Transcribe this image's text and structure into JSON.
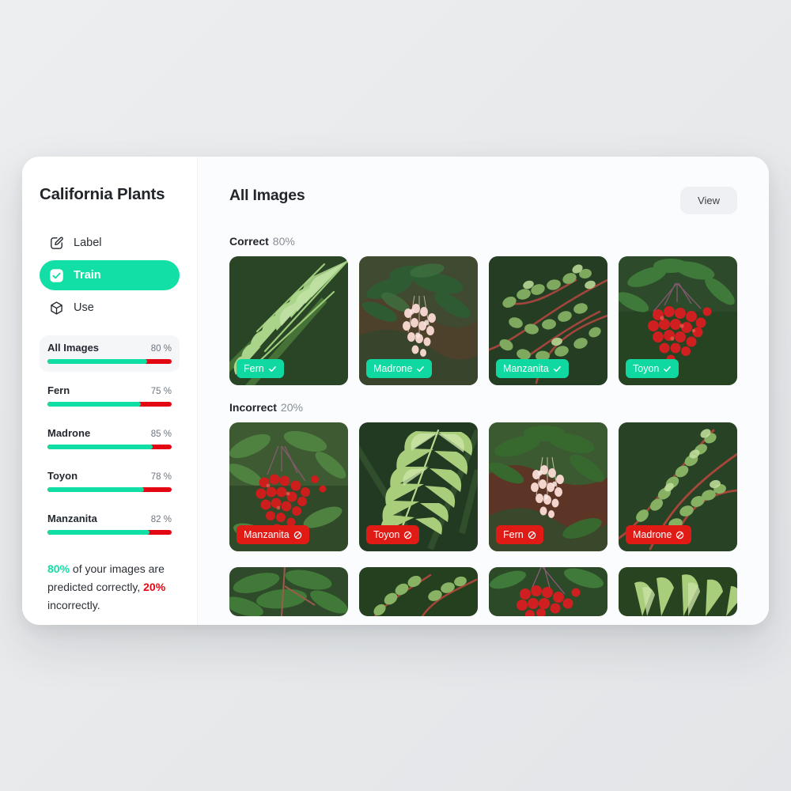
{
  "sidebar": {
    "app_title": "California Plants",
    "nav": [
      {
        "label": "Label",
        "icon": "pencil-square-icon",
        "active": false
      },
      {
        "label": "Train",
        "icon": "check-square-icon",
        "active": true
      },
      {
        "label": "Use",
        "icon": "cube-icon",
        "active": false
      }
    ],
    "progress": [
      {
        "name": "All Images",
        "value": "80 %",
        "pct": 80,
        "selected": true
      },
      {
        "name": "Fern",
        "value": "75 %",
        "pct": 75,
        "selected": false
      },
      {
        "name": "Madrone",
        "value": "85 %",
        "pct": 85,
        "selected": false
      },
      {
        "name": "Toyon",
        "value": "78 %",
        "pct": 78,
        "selected": false
      },
      {
        "name": "Manzanita",
        "value": "82 %",
        "pct": 82,
        "selected": false
      }
    ],
    "summary": {
      "correct_pct": "80%",
      "mid_text": " of your images are predicted correctly, ",
      "incorrect_pct": "20%",
      "tail_text": " incorrectly."
    }
  },
  "main": {
    "title": "All Images",
    "view_button": "View",
    "sections": [
      {
        "label": "Correct",
        "pct": "80%",
        "status": "ok",
        "cards": [
          {
            "label": "Fern",
            "art": "fern",
            "clipped": false
          },
          {
            "label": "Madrone",
            "art": "madrone",
            "clipped": false
          },
          {
            "label": "Manzanita",
            "art": "manzanita",
            "clipped": false
          },
          {
            "label": "Toyon",
            "art": "toyon",
            "clipped": false
          }
        ]
      },
      {
        "label": "Incorrect",
        "pct": "20%",
        "status": "bad",
        "cards": [
          {
            "label": "Manzanita",
            "art": "toyon",
            "clipped": false
          },
          {
            "label": "Toyon",
            "art": "fern",
            "clipped": false
          },
          {
            "label": "Fern",
            "art": "madrone",
            "clipped": false
          },
          {
            "label": "Madrone",
            "art": "manzanita",
            "clipped": false
          }
        ]
      },
      {
        "label": "",
        "pct": "",
        "status": "bad",
        "cards": [
          {
            "label": "",
            "art": "madrone",
            "clipped": true
          },
          {
            "label": "",
            "art": "manzanita",
            "clipped": true
          },
          {
            "label": "",
            "art": "toyon",
            "clipped": true
          },
          {
            "label": "",
            "art": "fern",
            "clipped": true
          }
        ]
      }
    ]
  },
  "colors": {
    "accent_green": "#10dfa5",
    "error_red": "#e30613",
    "page_bg": "#e9ebed",
    "panel_bg": "#ffffff"
  }
}
